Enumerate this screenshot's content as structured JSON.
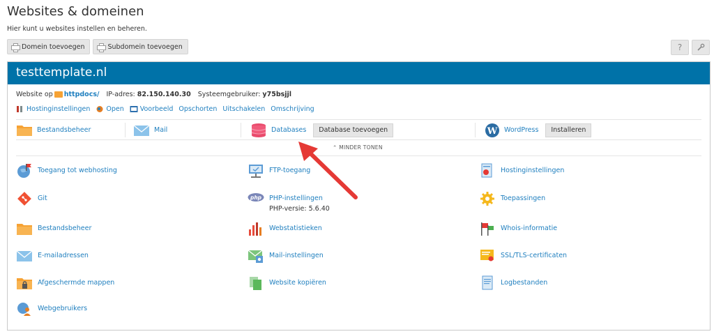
{
  "page": {
    "title": "Websites & domeinen",
    "subtitle": "Hier kunt u websites instellen en beheren."
  },
  "toolbar": {
    "add_domain": "Domein toevoegen",
    "add_subdomain": "Subdomein toevoegen",
    "help_icon": "?",
    "settings_icon": "wrench-icon"
  },
  "domain": {
    "name": "testtemplate.nl",
    "website_label": "Website op",
    "folder": "httpdocs/",
    "ip_label": "IP-adres:",
    "ip": "82.150.140.30",
    "user_label": "Systeemgebruiker:",
    "user": "y75bsjjl"
  },
  "actions": [
    "Hostinginstellingen",
    "Open",
    "Voorbeeld",
    "Opschorten",
    "Uitschakelen",
    "Omschrijving"
  ],
  "quick": {
    "file_manager": "Bestandsbeheer",
    "mail": "Mail",
    "databases": "Databases",
    "add_database": "Database toevoegen",
    "wordpress": "WordPress",
    "install": "Installeren"
  },
  "show_less": "MINDER TONEN",
  "tools": {
    "col1": [
      "Toegang tot webhosting",
      "Git",
      "Bestandsbeheer",
      "E-mailadressen",
      "Afgeschermde mappen",
      "Webgebruikers"
    ],
    "col2": [
      "FTP-toegang",
      "PHP-instellingen",
      "Webstatistieken",
      "Mail-instellingen",
      "Website kopiëren"
    ],
    "col3": [
      "Hostinginstellingen",
      "Toepassingen",
      "Whois-informatie",
      "SSL/TLS-certificaten",
      "Logbestanden"
    ],
    "php_version": "PHP-versie: 5.6.40"
  },
  "colors": {
    "header": "#0072a8",
    "link": "#1f7fbf",
    "folder": "#f6a234",
    "arrow": "#e53935"
  }
}
